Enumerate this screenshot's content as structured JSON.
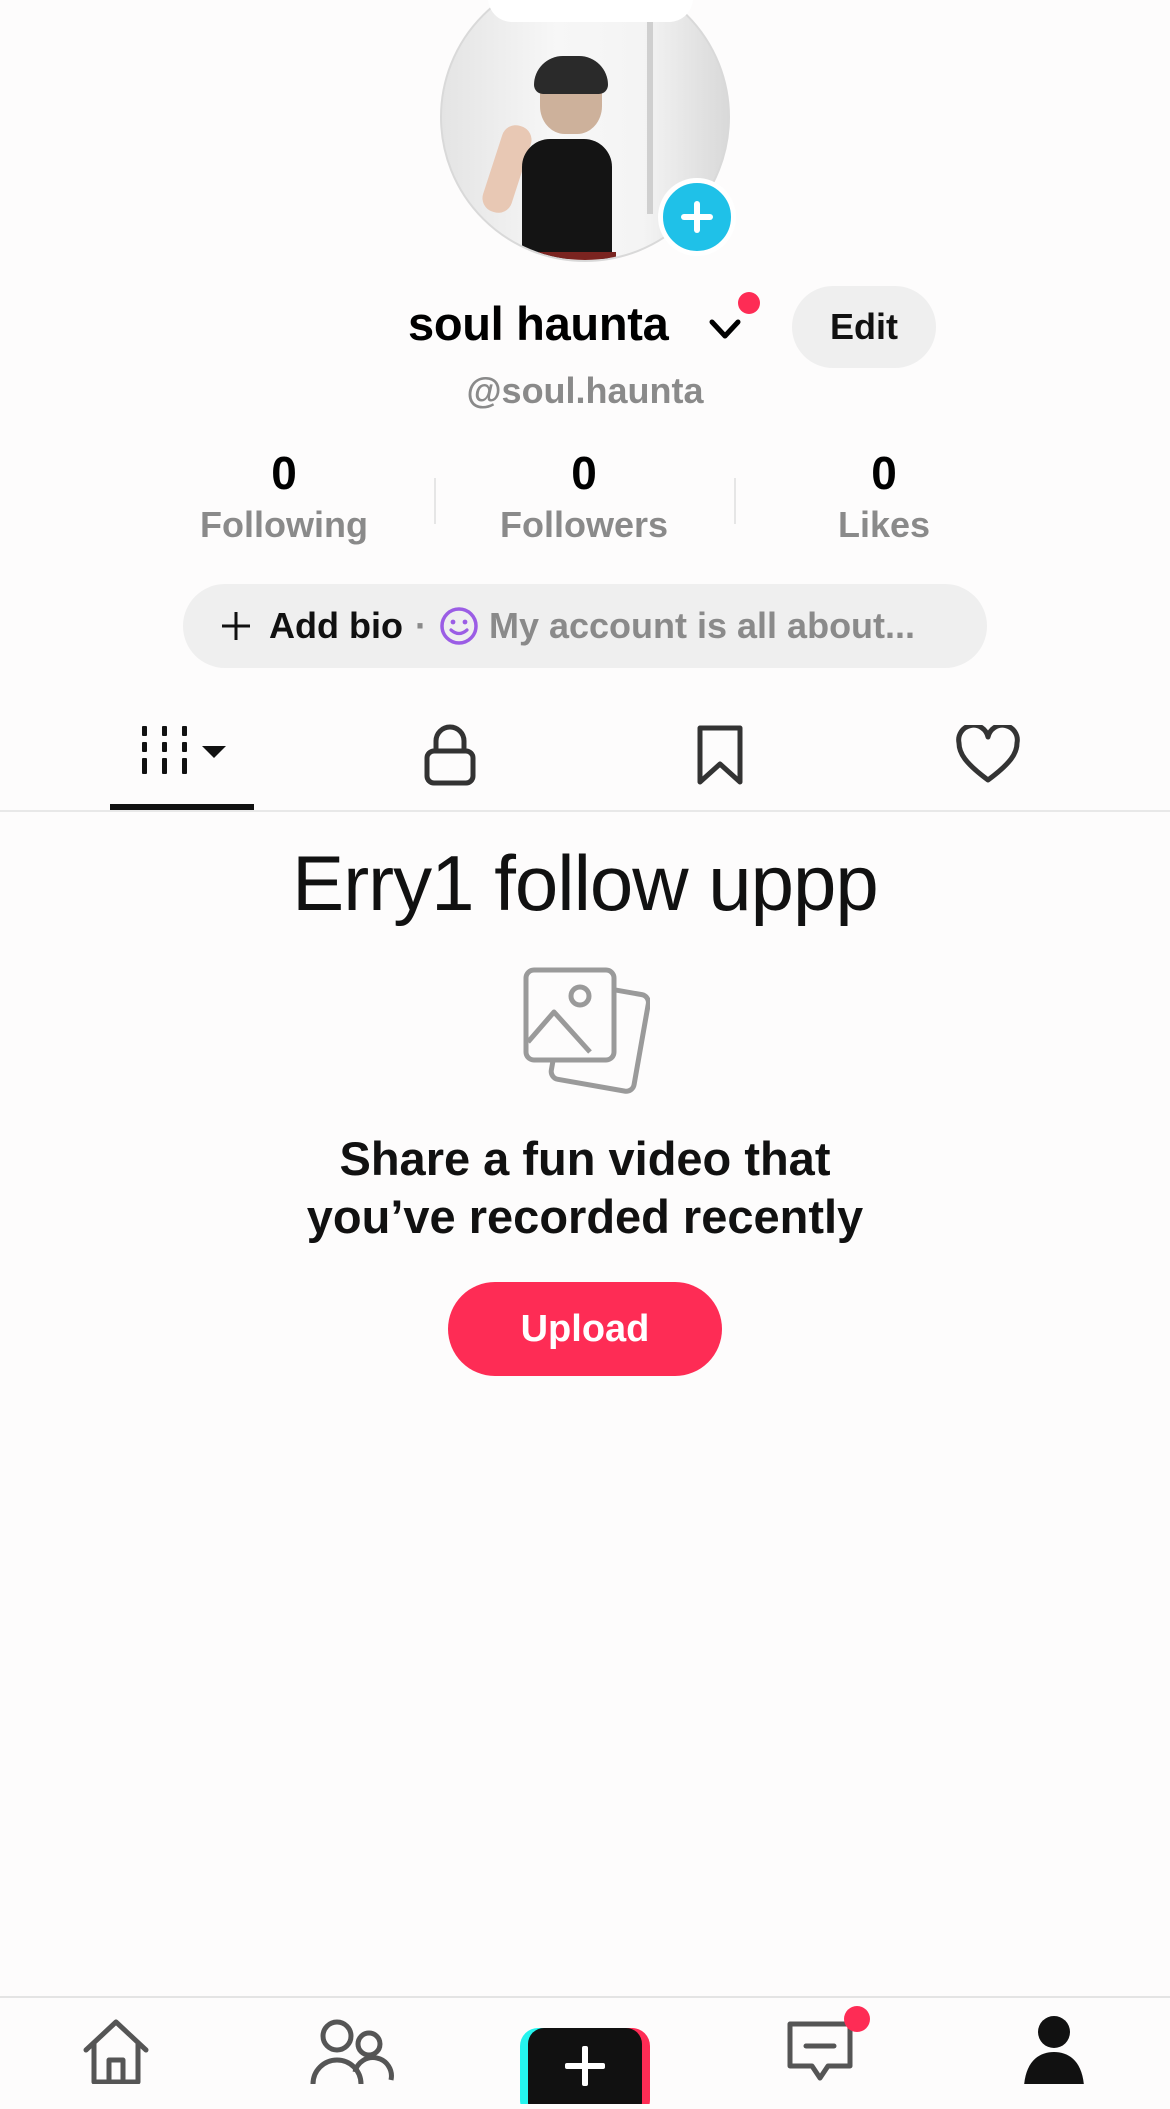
{
  "profile": {
    "display_name": "soul haunta",
    "handle": "@soul.haunta",
    "edit_label": "Edit"
  },
  "stats": [
    {
      "value": "0",
      "label": "Following"
    },
    {
      "value": "0",
      "label": "Followers"
    },
    {
      "value": "0",
      "label": "Likes"
    }
  ],
  "bio": {
    "add_label": "Add bio",
    "separator": "·",
    "placeholder": "My account is all about..."
  },
  "tabs": [
    {
      "icon": "grid-icon",
      "active": true
    },
    {
      "icon": "lock-icon",
      "active": false
    },
    {
      "icon": "bookmark-icon",
      "active": false
    },
    {
      "icon": "heart-icon",
      "active": false
    }
  ],
  "content": {
    "headline": "Erry1 follow uppp",
    "empty_line1": "Share a fun video that",
    "empty_line2": "you’ve recorded recently",
    "upload_label": "Upload"
  },
  "bottom_nav": {
    "items": [
      "home-icon",
      "friends-icon",
      "create-icon",
      "inbox-icon",
      "profile-icon"
    ],
    "inbox_has_notification": true
  },
  "colors": {
    "accent": "#fe2c55",
    "avatar_plus": "#1fc1e8",
    "muted_text": "#8a8a8a",
    "pill_bg": "#efefef"
  }
}
